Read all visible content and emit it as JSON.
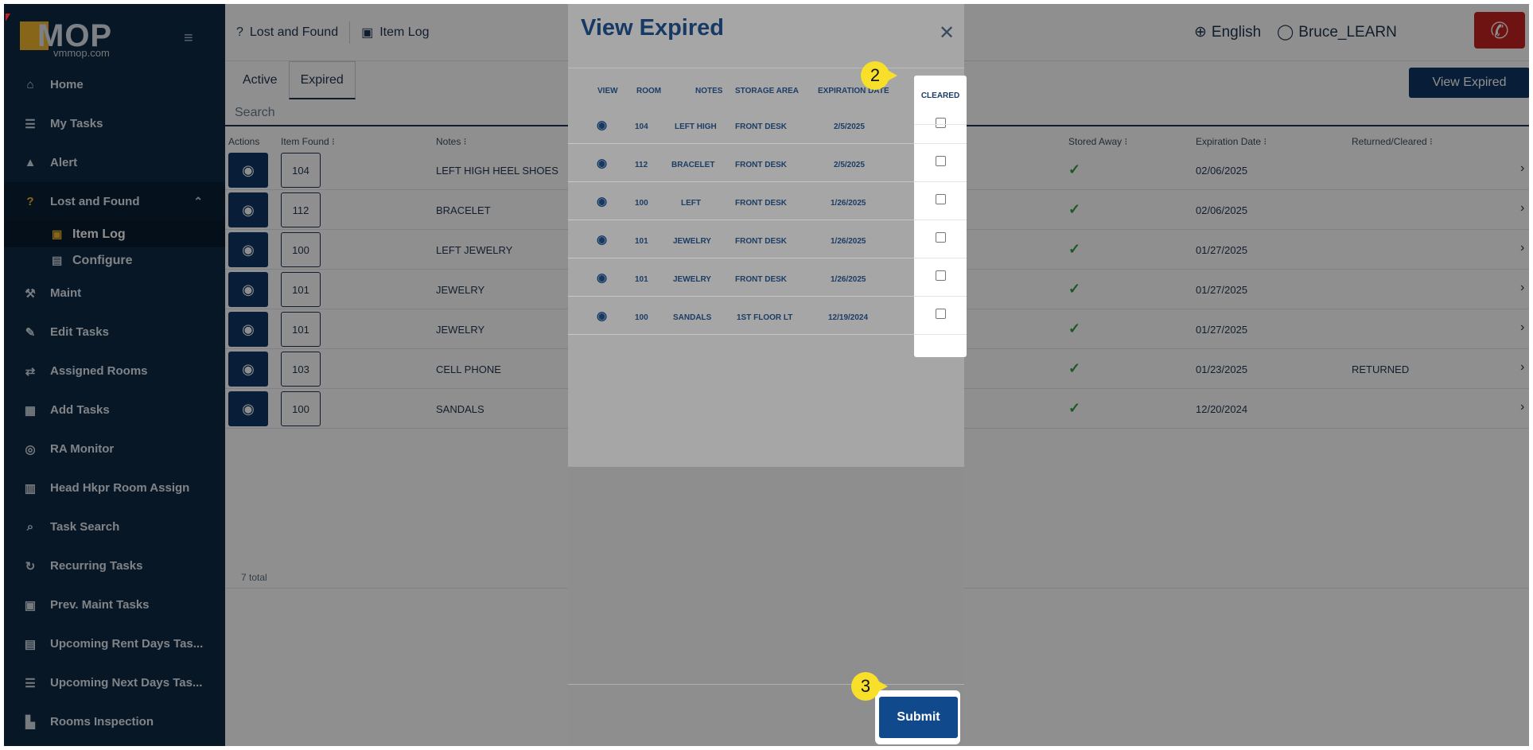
{
  "brand": {
    "logo_text": "MOP",
    "logo_sub": "vmmop.com"
  },
  "sidebar": {
    "items": [
      {
        "label": "Home",
        "icon": "home-icon",
        "glyph": "⌂"
      },
      {
        "label": "My Tasks",
        "icon": "list-icon",
        "glyph": "☰"
      },
      {
        "label": "Alert",
        "icon": "warning-icon",
        "glyph": "▲"
      },
      {
        "label": "Lost and Found",
        "icon": "lost-found-icon",
        "glyph": "❓"
      },
      {
        "label": "Item Log",
        "icon": "luggage-icon",
        "glyph": "🧳"
      },
      {
        "label": "Configure",
        "icon": "configure-icon",
        "glyph": "▤"
      },
      {
        "label": "Maint",
        "icon": "wrench-icon",
        "glyph": "🔧"
      },
      {
        "label": "Edit Tasks",
        "icon": "edit-icon",
        "glyph": "✎"
      },
      {
        "label": "Assigned Rooms",
        "icon": "swap-icon",
        "glyph": "⇄"
      },
      {
        "label": "Add Tasks",
        "icon": "table-icon",
        "glyph": "▦"
      },
      {
        "label": "RA Monitor",
        "icon": "binoculars-icon",
        "glyph": "◎"
      },
      {
        "label": "Head Hkpr Room Assign",
        "icon": "building-icon",
        "glyph": "▥"
      },
      {
        "label": "Task Search",
        "icon": "search-icon",
        "glyph": "⌕"
      },
      {
        "label": "Recurring Tasks",
        "icon": "refresh-icon",
        "glyph": "↻"
      },
      {
        "label": "Prev. Maint Tasks",
        "icon": "calendar-icon",
        "glyph": "▣"
      },
      {
        "label": "Upcoming Rent Days Tas...",
        "icon": "clipboard-icon",
        "glyph": "▤"
      },
      {
        "label": "Upcoming Next Days Tas...",
        "icon": "list-icon",
        "glyph": "☰"
      },
      {
        "label": "Rooms Inspection",
        "icon": "inspection-icon",
        "glyph": "▙"
      }
    ]
  },
  "topbar": {
    "crumb1": "Lost and Found",
    "crumb2": "Item Log",
    "language": "English",
    "user": "Bruce_LEARN"
  },
  "tabs": {
    "active": "Active",
    "expired": "Expired"
  },
  "view_expired_label": "View Expired",
  "search_placeholder": "Search",
  "table": {
    "headers": {
      "actions": "Actions",
      "item_found": "Item Found ⁝",
      "notes": "Notes ⁝",
      "stored_away": "Stored Away ⁝",
      "expiration_date": "Expiration Date ⁝",
      "returned_cleared": "Returned/Cleared ⁝"
    },
    "rows": [
      {
        "room": "104",
        "notes": "LEFT HIGH HEEL SHOES",
        "exp": "02/06/2025",
        "ret": ""
      },
      {
        "room": "112",
        "notes": "BRACELET",
        "exp": "02/06/2025",
        "ret": ""
      },
      {
        "room": "100",
        "notes": "LEFT JEWELRY",
        "exp": "01/27/2025",
        "ret": ""
      },
      {
        "room": "101",
        "notes": "JEWELRY",
        "exp": "01/27/2025",
        "ret": ""
      },
      {
        "room": "101",
        "notes": "JEWELRY",
        "exp": "01/27/2025",
        "ret": ""
      },
      {
        "room": "103",
        "notes": "CELL PHONE",
        "exp": "01/23/2025",
        "ret": "RETURNED"
      },
      {
        "room": "100",
        "notes": "SANDALS",
        "exp": "12/20/2024",
        "ret": ""
      }
    ],
    "total": "7 total"
  },
  "modal": {
    "title": "View Expired",
    "headers": {
      "view": "VIEW",
      "room": "ROOM",
      "notes": "NOTES",
      "storage": "STORAGE AREA",
      "expiration": "EXPIRATION DATE",
      "cleared": "CLEARED"
    },
    "rows": [
      {
        "room": "104",
        "notes": "LEFT HIGH",
        "storage": "FRONT DESK",
        "date": "2/5/2025",
        "cleared": false
      },
      {
        "room": "112",
        "notes": "BRACELET",
        "storage": "FRONT DESK",
        "date": "2/5/2025",
        "cleared": false
      },
      {
        "room": "100",
        "notes": "LEFT",
        "storage": "FRONT DESK",
        "date": "1/26/2025",
        "cleared": false
      },
      {
        "room": "101",
        "notes": "JEWELRY",
        "storage": "FRONT DESK",
        "date": "1/26/2025",
        "cleared": false
      },
      {
        "room": "101",
        "notes": "JEWELRY",
        "storage": "FRONT DESK",
        "date": "1/26/2025",
        "cleared": false
      },
      {
        "room": "100",
        "notes": "SANDALS",
        "storage": "1ST FLOOR LT",
        "date": "12/19/2024",
        "cleared": false
      }
    ],
    "submit_label": "Submit"
  },
  "callouts": {
    "step2": "2",
    "step3": "3"
  },
  "colors": {
    "sidebar": "#0e2a44",
    "accent": "#f0b72f",
    "primary": "#0f3664",
    "callout": "#f8e02a",
    "phone": "#c62020"
  }
}
